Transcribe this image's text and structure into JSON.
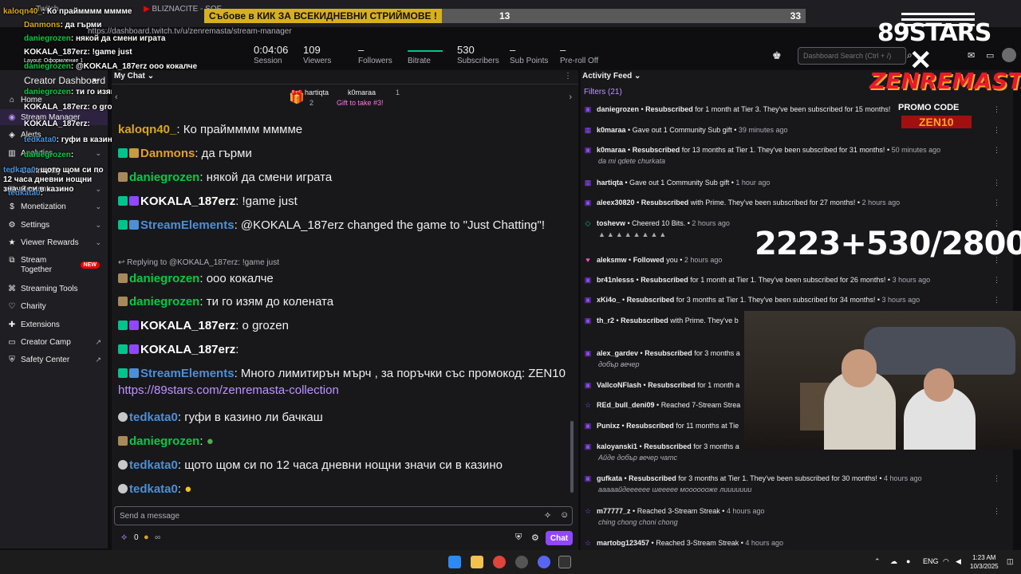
{
  "browser": {
    "tab1": "Twitch",
    "tab2": "BLIZNACITE - SOF...",
    "url": "https://dashboard.twitch.tv/u/zenremasta/stream-manager"
  },
  "banner": {
    "text": "Събове в КИК ЗА ВСЕКИДНЕВНИ СТРИЙМОВЕ !",
    "count1": "13",
    "count2": "33"
  },
  "stats": [
    {
      "value": "0:04:06",
      "label": "Session"
    },
    {
      "value": "109",
      "label": "Viewers"
    },
    {
      "value": "–",
      "label": "Followers"
    },
    {
      "value": "",
      "label": "Bitrate"
    },
    {
      "value": "530",
      "label": "Subscribers"
    },
    {
      "value": "–",
      "label": "Sub Points"
    },
    {
      "value": "–",
      "label": "Pre-roll Off"
    }
  ],
  "search": {
    "placeholder": "Dashboard Search (Ctrl + /)"
  },
  "sidebar": {
    "title": "Creator Dashboard",
    "items": [
      {
        "label": "Home",
        "icon": "home-icon"
      },
      {
        "label": "Stream Manager",
        "icon": "stream-icon"
      },
      {
        "label": "Alerts",
        "icon": "alert-icon"
      },
      {
        "label": "Analytics",
        "icon": "chart-icon"
      },
      {
        "label": "Community",
        "icon": "people-icon"
      },
      {
        "label": "Content",
        "icon": "content-icon"
      },
      {
        "label": "Monetization",
        "icon": "money-icon"
      },
      {
        "label": "Settings",
        "icon": "gear-icon"
      },
      {
        "label": "Viewer Rewards",
        "icon": "reward-icon"
      },
      {
        "label": "Stream Together",
        "icon": "together-icon",
        "badge": "NEW"
      },
      {
        "label": "Streaming Tools",
        "icon": "tools-icon"
      },
      {
        "label": "Charity",
        "icon": "charity-icon"
      },
      {
        "label": "Extensions",
        "icon": "extension-icon"
      },
      {
        "label": "Creator Camp",
        "icon": "camp-icon"
      },
      {
        "label": "Safety Center",
        "icon": "safety-icon"
      }
    ]
  },
  "overlay_chat": [
    {
      "user": "kaloqn40_",
      "text": "Ко праймммм мммме"
    },
    {
      "user": "Danmons",
      "text": "да гърми"
    },
    {
      "user": "daniegrozen",
      "text": "някой да смени играта"
    },
    {
      "user": "KOKALA_187erz",
      "text": "!game just"
    },
    {
      "user": "",
      "text": "Layout: Оформление 1"
    },
    {
      "user": "daniegrozen",
      "text": "@KOKALA_187erz ооо кокалче"
    },
    {
      "user": "daniegrozen",
      "text": "ти го изям до колената"
    },
    {
      "user": "KOKALA_187erz",
      "text": "о grozen"
    },
    {
      "user": "KOKALA_187erz",
      "text": ""
    },
    {
      "user": "tedkata0",
      "text": "гуфи в казино ли бачкаш"
    },
    {
      "user": "daniegrozen",
      "text": ""
    },
    {
      "user": "tedkata0",
      "text": "щото щом си по 12 часа дневни нощни значи си в казино"
    },
    {
      "user": "tedkata0",
      "text": ""
    }
  ],
  "chat": {
    "title": "My Chat",
    "gifts": [
      {
        "user": "hartiqta",
        "count": "2"
      },
      {
        "user": "k0maraa",
        "count": "1",
        "note": "Gift to take #3!"
      }
    ],
    "messages": [
      {
        "user": "kaloqn40_",
        "text": ": Ко праймммм мммме"
      },
      {
        "user": "Danmons",
        "text": ": да гърми"
      },
      {
        "user": "daniegrozen",
        "text": ": някой да смени играта"
      },
      {
        "user": "KOKALA_187erz",
        "text": ": !game just"
      },
      {
        "user": "StreamElements",
        "text": ": @KOKALA_187erz changed the game to \"Just Chatting\"!"
      },
      {
        "user": "daniegrozen",
        "text": ": ооо кокалче"
      },
      {
        "user": "daniegrozen",
        "text": ": ти го изям до колената"
      },
      {
        "user": "KOKALA_187erz",
        "text": ": о grozen"
      },
      {
        "user": "KOKALA_187erz",
        "text": ":"
      },
      {
        "user": "StreamElements",
        "text": ": Много лимитирън мърч , за поръчки със промокод: ZEN10 ",
        "link": "https://89stars.com/zenremasta-collection"
      },
      {
        "user": "tedkata0",
        "text": ": гуфи в казино ли бачкаш"
      },
      {
        "user": "daniegrozen",
        "text": ":"
      },
      {
        "user": "tedkata0",
        "text": ": щото щом си по 12 часа дневни нощни значи си в казино"
      },
      {
        "user": "tedkata0",
        "text": ":"
      }
    ],
    "reply_label": "Replying to @KOKALA_187erz: !game just",
    "input_placeholder": "Send a message",
    "points": "0",
    "infinity": "∞",
    "chat_button": "Chat"
  },
  "feed": {
    "title": "Activity Feed",
    "filters": "Filters (21)",
    "rows": [
      {
        "user": "daniegrozen",
        "action": "Resubscribed",
        "rest": " for 1 month at Tier 3. They've been subscribed for 15 months!",
        "time": "",
        "msg": ""
      },
      {
        "user": "k0maraa",
        "action": "Gave out 1 Community Sub gift",
        "rest": "",
        "time": "39 minutes ago",
        "msg": ""
      },
      {
        "user": "k0maraa",
        "action": "Resubscribed",
        "rest": " for 13 months at Tier 1. They've been subscribed for 31 months!",
        "time": "50 minutes ago",
        "msg": "da mi qdete churkata"
      },
      {
        "user": "hartiqta",
        "action": "Gave out 1 Community Sub gift",
        "rest": "",
        "time": "1 hour ago",
        "msg": ""
      },
      {
        "user": "aleex30820",
        "action": "Resubscribed",
        "rest": " with Prime. They've been subscribed for 27 months!",
        "time": "2 hours ago",
        "msg": ""
      },
      {
        "user": "toshevw",
        "action": "Cheered 10 Bits.",
        "rest": "",
        "time": "2 hours ago",
        "msg": ""
      },
      {
        "user": "aleksmw",
        "action": "Followed",
        "rest": " you",
        "time": "2 hours ago",
        "msg": ""
      },
      {
        "user": "br41nlesss",
        "action": "Resubscribed",
        "rest": " for 1 month at Tier 1. They've been subscribed for 26 months!",
        "time": "3 hours ago",
        "msg": ""
      },
      {
        "user": "xKi4o_",
        "action": "Resubscribed",
        "rest": " for 3 months at Tier 1. They've been subscribed for 34 months!",
        "time": "3 hours ago",
        "msg": ""
      },
      {
        "user": "th_r2",
        "action": "Resubscribed",
        "rest": " with Prime. They've b",
        "time": "",
        "msg": ""
      },
      {
        "user": "alex_gardev",
        "action": "Resubscribed",
        "rest": " for 3 months a",
        "time": "",
        "msg": "добър вечер"
      },
      {
        "user": "VallcoNFlash",
        "action": "Resubscribed",
        "rest": " for 1 month a",
        "time": "",
        "msg": ""
      },
      {
        "user": "REd_bull_deni09",
        "action": "Reached 7-Stream Strea",
        "rest": "",
        "time": "",
        "msg": ""
      },
      {
        "user": "Punixz",
        "action": "Resubscribed",
        "rest": " for 11 months at Tie",
        "time": "",
        "msg": ""
      },
      {
        "user": "kaloyanski1",
        "action": "Resubscribed",
        "rest": " for 3 months a",
        "time": "",
        "msg": "Айде добър вечер чатс"
      },
      {
        "user": "gufkata",
        "action": "Resubscribed",
        "rest": " for 3 months at Tier 1. They've been subscribed for 30 months!",
        "time": "4 hours ago",
        "msg": "ааааайдееееее шеееее мооооооже лиииииии"
      },
      {
        "user": "m77777_z",
        "action": "Reached 3-Stream Streak",
        "rest": "",
        "time": "4 hours ago",
        "msg": "ching chong choni chong"
      },
      {
        "user": "martobg123457",
        "action": "Reached 3-Stream Streak",
        "rest": "",
        "time": "4 hours ago",
        "msg": ""
      }
    ]
  },
  "overlay": {
    "logo": "89STARS",
    "zen_title": "ZENREMASTA",
    "promo_label": "PROMO CODE",
    "promo_code": "ZEN10",
    "big_counter": "2223+530/2800"
  },
  "taskbar": {
    "lang": "ENG",
    "time": "1:23 AM",
    "date": "10/3/2025"
  },
  "colors": {
    "accent": "#9147ff",
    "gold": "#daa520",
    "green": "#00cc44",
    "blue": "#4a90d9"
  }
}
